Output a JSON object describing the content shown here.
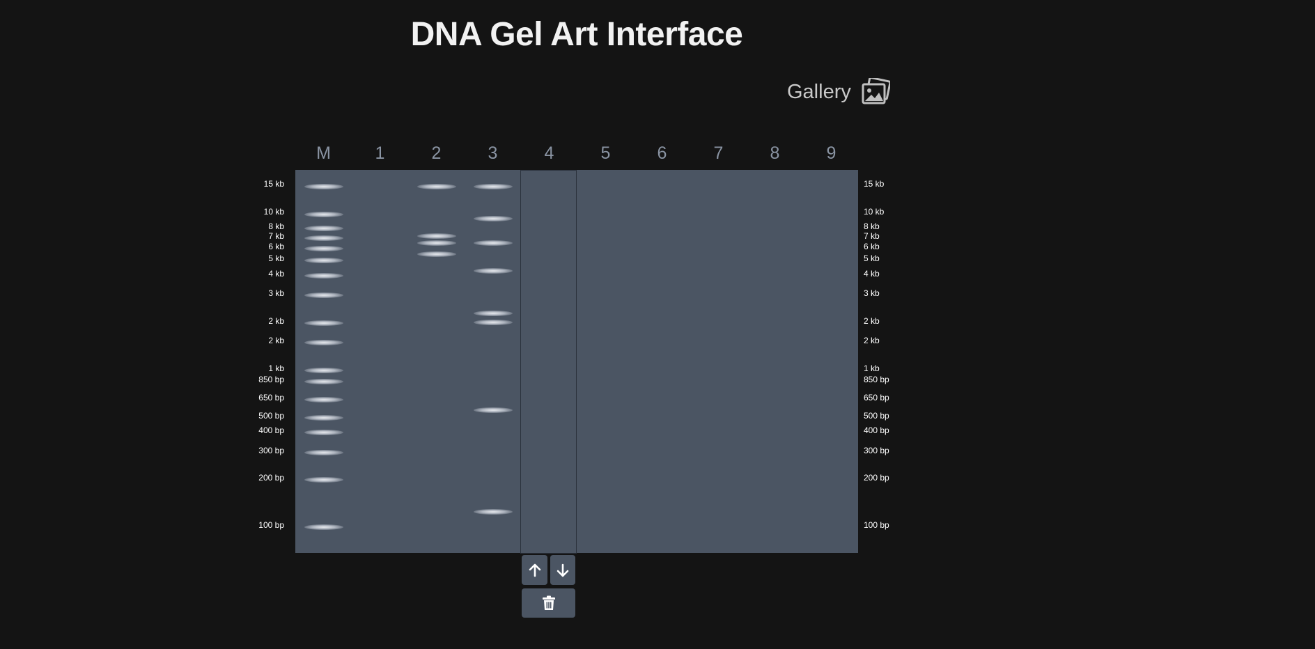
{
  "title": "DNA Gel Art Interface",
  "gallery": {
    "label": "Gallery",
    "icon": "photo-gallery-icon"
  },
  "lanes": [
    "M",
    "1",
    "2",
    "3",
    "4",
    "5",
    "6",
    "7",
    "8",
    "9"
  ],
  "selected_lane": "4",
  "size_labels": [
    "15 kb",
    "10 kb",
    "8 kb",
    "7 kb",
    "6 kb",
    "5 kb",
    "4 kb",
    "3 kb",
    "2 kb",
    "2 kb",
    "1 kb",
    "850 bp",
    "650 bp",
    "500 bp",
    "400 bp",
    "300 bp",
    "200 bp",
    "100 bp"
  ],
  "lane_bands": {
    "M": [
      "15 kb",
      "10 kb",
      "8 kb",
      "7 kb",
      "6 kb",
      "5 kb",
      "4 kb",
      "3 kb",
      "2 kb",
      "2 kb",
      "1 kb",
      "850 bp",
      "650 bp",
      "500 bp",
      "400 bp",
      "300 bp",
      "200 bp",
      "100 bp"
    ],
    "2": [
      "15 kb",
      "7 kb",
      "6.5 kb",
      "5.5 kb"
    ],
    "3": [
      "15 kb",
      "9 kb",
      "6 kb",
      "4 kb",
      "2 kb",
      "1.9 kb",
      "500 bp",
      "120 bp"
    ]
  },
  "controls": {
    "move_up_icon": "arrow-up-icon",
    "move_down_icon": "arrow-down-icon",
    "delete_icon": "trash-icon"
  },
  "colors": {
    "background": "#141414",
    "gel": "#4b5563",
    "band": "#e6e9ee",
    "lane_header": "#8a94a3"
  }
}
